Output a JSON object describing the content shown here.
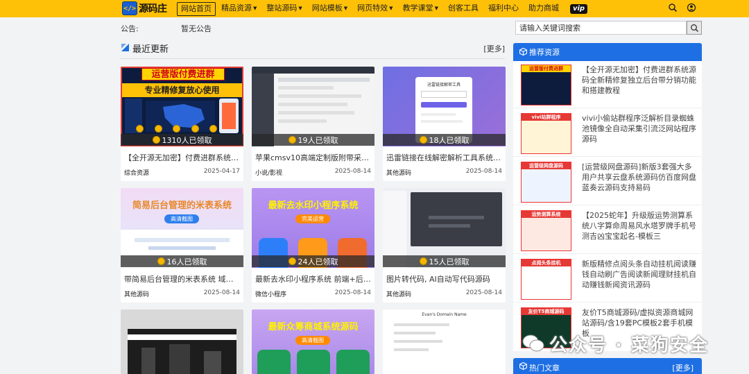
{
  "brand": {
    "logo_glyph": "</>",
    "name": "源码庄",
    "accent": "#ffc107",
    "blue": "#1e6fe3"
  },
  "nav": {
    "items": [
      {
        "label": "网站首页",
        "caret": false,
        "active": true
      },
      {
        "label": "精品资源",
        "caret": true
      },
      {
        "label": "整站源码",
        "caret": true
      },
      {
        "label": "网站模板",
        "caret": true
      },
      {
        "label": "网页特效",
        "caret": true
      },
      {
        "label": "教学课堂",
        "caret": true
      },
      {
        "label": "创客工具",
        "caret": false
      },
      {
        "label": "福利中心",
        "caret": false
      },
      {
        "label": "助力商城",
        "caret": false
      }
    ],
    "vip": "vip"
  },
  "notice": {
    "label": "公告:",
    "text": "暂无公告"
  },
  "search": {
    "placeholder": "请输入关键词搜索"
  },
  "latest": {
    "title": "最近更新",
    "more": "[更多]"
  },
  "cards": [
    {
      "claim": "1310人已领取",
      "title": "【全开源无加密】付费进群系统源码...",
      "category": "综合资源",
      "date": "2025-04-17",
      "banner1": "运营版付费进群",
      "banner2": "专业精修复放心使用"
    },
    {
      "claim": "19人已领取",
      "title": "苹果cmsv10高端定制版附带采集...",
      "category": "小说/影视",
      "date": "2025-08-14"
    },
    {
      "claim": "18人已领取",
      "title": "迅雷链接在线解密解析工具系统源...",
      "category": "其他源码",
      "date": "2025-08-14",
      "panel_title": "迅雷链接解密工具"
    },
    {
      "claim": "16人已领取",
      "title": "带简易后台管理的米表系统 域名...",
      "category": "其他源码",
      "date": "2025-08-14",
      "banner1": "简易后台管理的米表系统",
      "button": "高清截图"
    },
    {
      "claim": "24人已领取",
      "title": "最新去水印小程序系统 前端+后端...",
      "category": "微信小程序",
      "date": "2025-08-14",
      "banner1": "最新去水印小程序系统",
      "button": "完美运营"
    },
    {
      "claim": "15人已领取",
      "title": "图片转代码, AI自动写代码源码",
      "category": "其他源码",
      "date": "2025-08-14"
    },
    {
      "title": "",
      "category": "",
      "date": ""
    },
    {
      "title": "",
      "category": "",
      "date": "",
      "banner1": "最新众筹商城系统源码",
      "button": "高清截图"
    },
    {
      "title": "",
      "category": "",
      "date": "",
      "panel_title": "Evan's Domain Name"
    }
  ],
  "sidebar": {
    "title": "推荐资源",
    "items": [
      {
        "text": "【全开源无加密】付费进群系统源码全新精修复独立后台带分销功能和搭建教程",
        "thumb": "运营版付费进群"
      },
      {
        "text": "vivi小偷站群程序泛解析目录蜘蛛池镜像全自动采集引流泛网站程序源码",
        "thumb": "vivi站群程序"
      },
      {
        "text": "[运营级网盘源码]新版3套强大多用户共享云盘系统源码仿百度网盘蓝奏云源码支持易码",
        "thumb": "运营级网盘源码"
      },
      {
        "text": "【2025蛇年】升级版运势测算系统八字算命周易风水塔罗牌手机号测吉凶宝宝起名-模板三",
        "thumb": "运势测算系统"
      },
      {
        "text": "新版精修点阅头条自动挂机阅读赚钱自动刷广告阅读新闻理财挂机自动赚钱新闻资讯源码",
        "thumb": "点阅头条挂机"
      },
      {
        "text": "友价T5商城源码/虚拟资源商城网站源码/含19套PC模板2套手机模板",
        "thumb": "友价T5商城源码"
      }
    ]
  },
  "hot": {
    "title": "热门文章",
    "more": "[更多]"
  },
  "watermark": "公众号 · 菜狗安全"
}
